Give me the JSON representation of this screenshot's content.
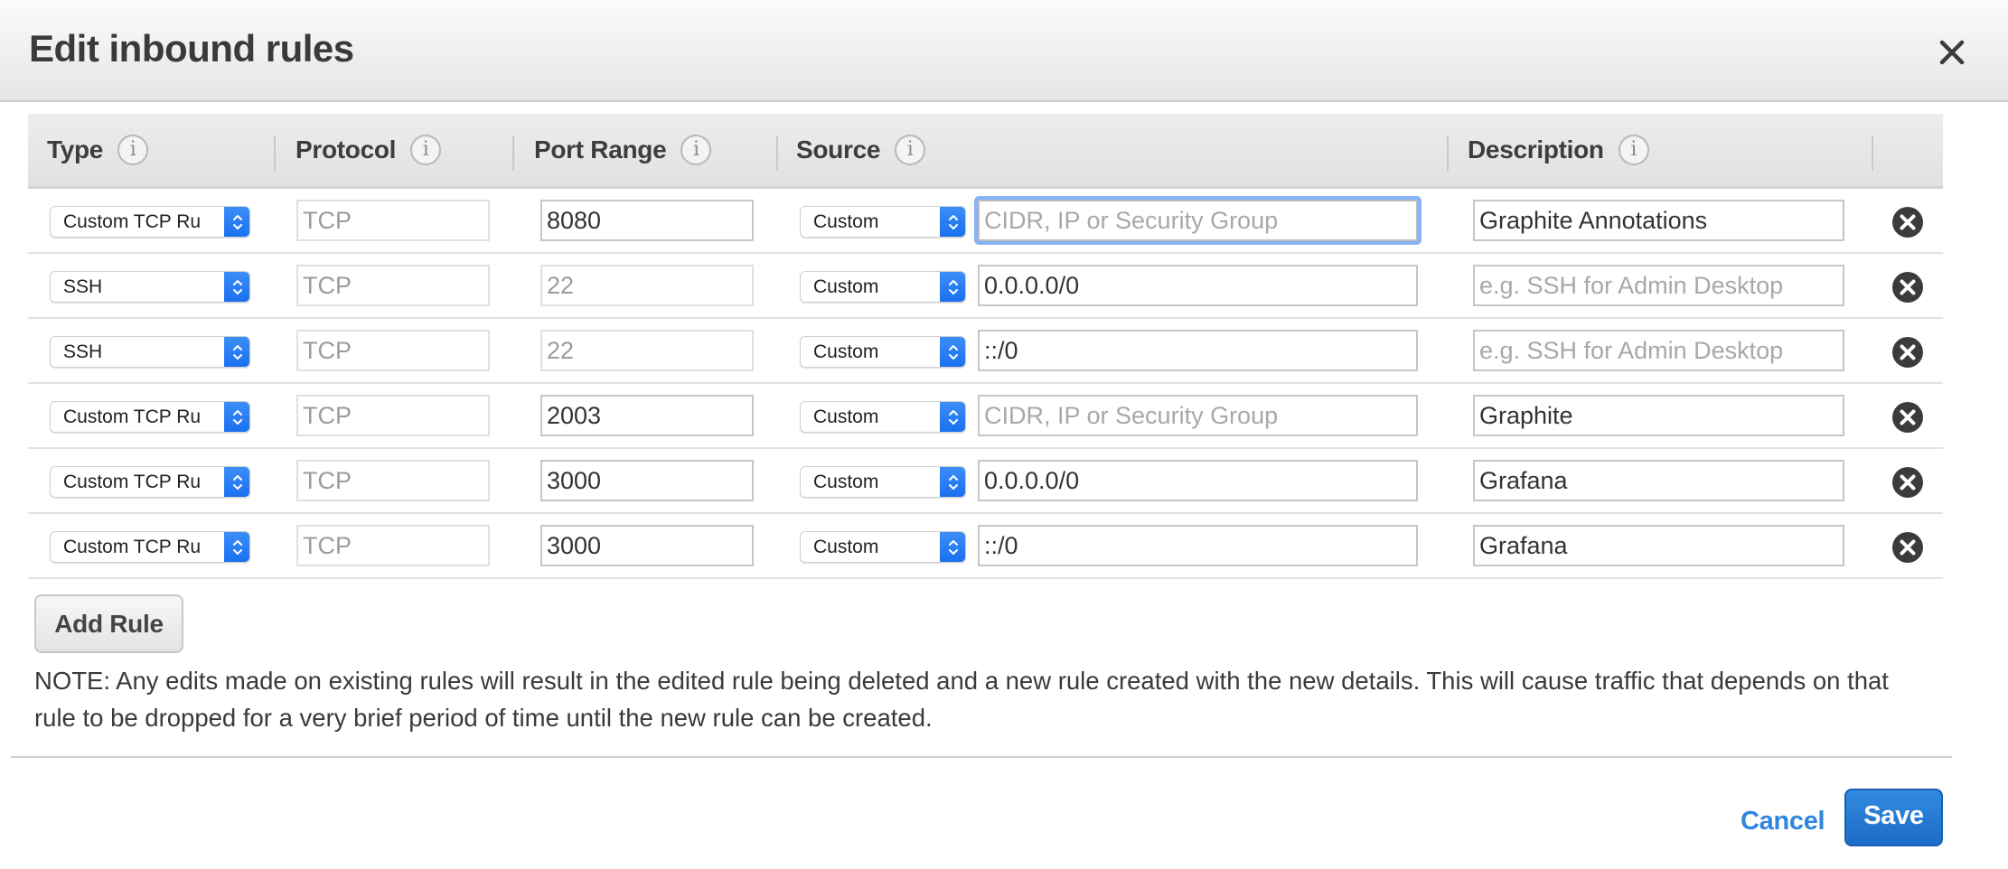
{
  "dialog": {
    "title": "Edit inbound rules",
    "close_icon": "close-x-icon"
  },
  "table": {
    "columns": [
      {
        "label": "Type",
        "info_icon": "info-icon"
      },
      {
        "label": "Protocol",
        "info_icon": "info-icon"
      },
      {
        "label": "Port Range",
        "info_icon": "info-icon"
      },
      {
        "label": "Source",
        "info_icon": "info-icon"
      },
      {
        "label": "Description",
        "info_icon": "info-icon"
      }
    ],
    "info_glyph": "i",
    "source_placeholder": "CIDR, IP or Security Group",
    "description_placeholder": "e.g. SSH for Admin Desktop",
    "rows": [
      {
        "type": "Custom TCP Ru",
        "protocol": "TCP",
        "port_range": "8080",
        "port_editable": true,
        "source_type": "Custom",
        "source": "",
        "source_focused": true,
        "description": "Graphite Annotations"
      },
      {
        "type": "SSH",
        "protocol": "TCP",
        "port_range": "22",
        "port_editable": false,
        "source_type": "Custom",
        "source": "0.0.0.0/0",
        "source_focused": false,
        "description": ""
      },
      {
        "type": "SSH",
        "protocol": "TCP",
        "port_range": "22",
        "port_editable": false,
        "source_type": "Custom",
        "source": "::/0",
        "source_focused": false,
        "description": ""
      },
      {
        "type": "Custom TCP Ru",
        "protocol": "TCP",
        "port_range": "2003",
        "port_editable": true,
        "source_type": "Custom",
        "source": "",
        "source_focused": false,
        "description": "Graphite"
      },
      {
        "type": "Custom TCP Ru",
        "protocol": "TCP",
        "port_range": "3000",
        "port_editable": true,
        "source_type": "Custom",
        "source": "0.0.0.0/0",
        "source_focused": false,
        "description": "Grafana"
      },
      {
        "type": "Custom TCP Ru",
        "protocol": "TCP",
        "port_range": "3000",
        "port_editable": true,
        "source_type": "Custom",
        "source": "::/0",
        "source_focused": false,
        "description": "Grafana"
      }
    ]
  },
  "actions": {
    "add_rule_label": "Add Rule",
    "note": "NOTE: Any edits made on existing rules will result in the edited rule being deleted and a new rule created with the new details. This will cause traffic that depends on that rule to be dropped for a very brief period of time until the new rule can be created.",
    "cancel_label": "Cancel",
    "save_label": "Save"
  },
  "colors": {
    "accent": "#1f72d0",
    "link": "#2e86e0",
    "focus_ring": "#86b3f7",
    "select_arrow": "#1a6ff0"
  }
}
